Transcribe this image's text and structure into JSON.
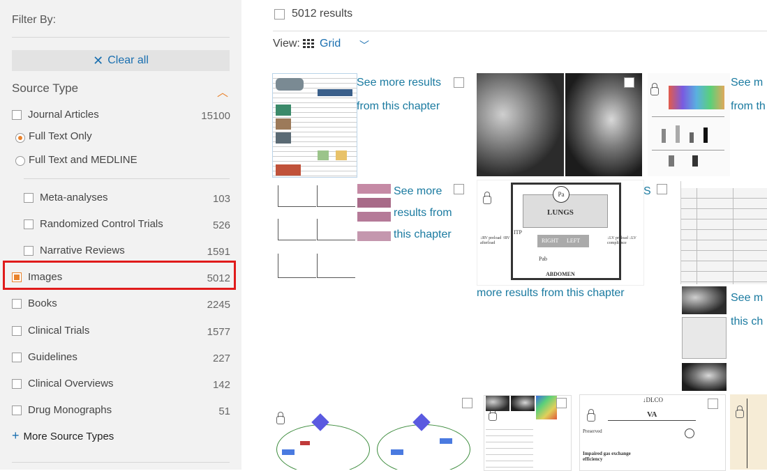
{
  "sidebar": {
    "filter_by": "Filter By:",
    "clear_all": "Clear all",
    "source_type": "Source Type",
    "items": [
      {
        "label": "Journal Articles",
        "count": "15100"
      },
      {
        "label": "Meta-analyses",
        "count": "103"
      },
      {
        "label": "Randomized Control Trials",
        "count": "526"
      },
      {
        "label": "Narrative Reviews",
        "count": "1591"
      },
      {
        "label": "Images",
        "count": "5012"
      },
      {
        "label": "Books",
        "count": "2245"
      },
      {
        "label": "Clinical Trials",
        "count": "1577"
      },
      {
        "label": "Guidelines",
        "count": "227"
      },
      {
        "label": "Clinical Overviews",
        "count": "142"
      },
      {
        "label": "Drug Monographs",
        "count": "51"
      }
    ],
    "radio_options": [
      {
        "label": "Full Text Only",
        "selected": true
      },
      {
        "label": "Full Text and MEDLINE",
        "selected": false
      }
    ],
    "more_types": "More Source Types"
  },
  "main": {
    "results_count": "5012 results",
    "view_label": "View:",
    "view_mode": "Grid",
    "links": {
      "r1a": "See more results",
      "r1b": "from this chapter",
      "r1c": "See m",
      "r1d": "from th",
      "r2a": "See more",
      "r2b": "results from",
      "r2c": "this chapter",
      "r2d": "S",
      "r2e": "more results from this chapter",
      "r3a": "See m",
      "r3b": "this ch"
    },
    "diagram_labels": {
      "lungs": "LUNGS",
      "right": "RIGHT",
      "left": "LEFT",
      "abdomen": "ABDOMEN",
      "pa": "Pa",
      "pab": "Pab",
      "itp": "ITP",
      "rv": "↓RV preload ↑RV afterload",
      "lv": "↓LV preload ↓LV compliance",
      "dlco": "↓DLCO",
      "va": "VA",
      "preserved": "Preserved",
      "impaired": "Impaired gas exchange efficiency"
    }
  },
  "colors": {
    "accent": "#e9822c",
    "link": "#1a7aa0",
    "highlight": "#e01b1b"
  }
}
